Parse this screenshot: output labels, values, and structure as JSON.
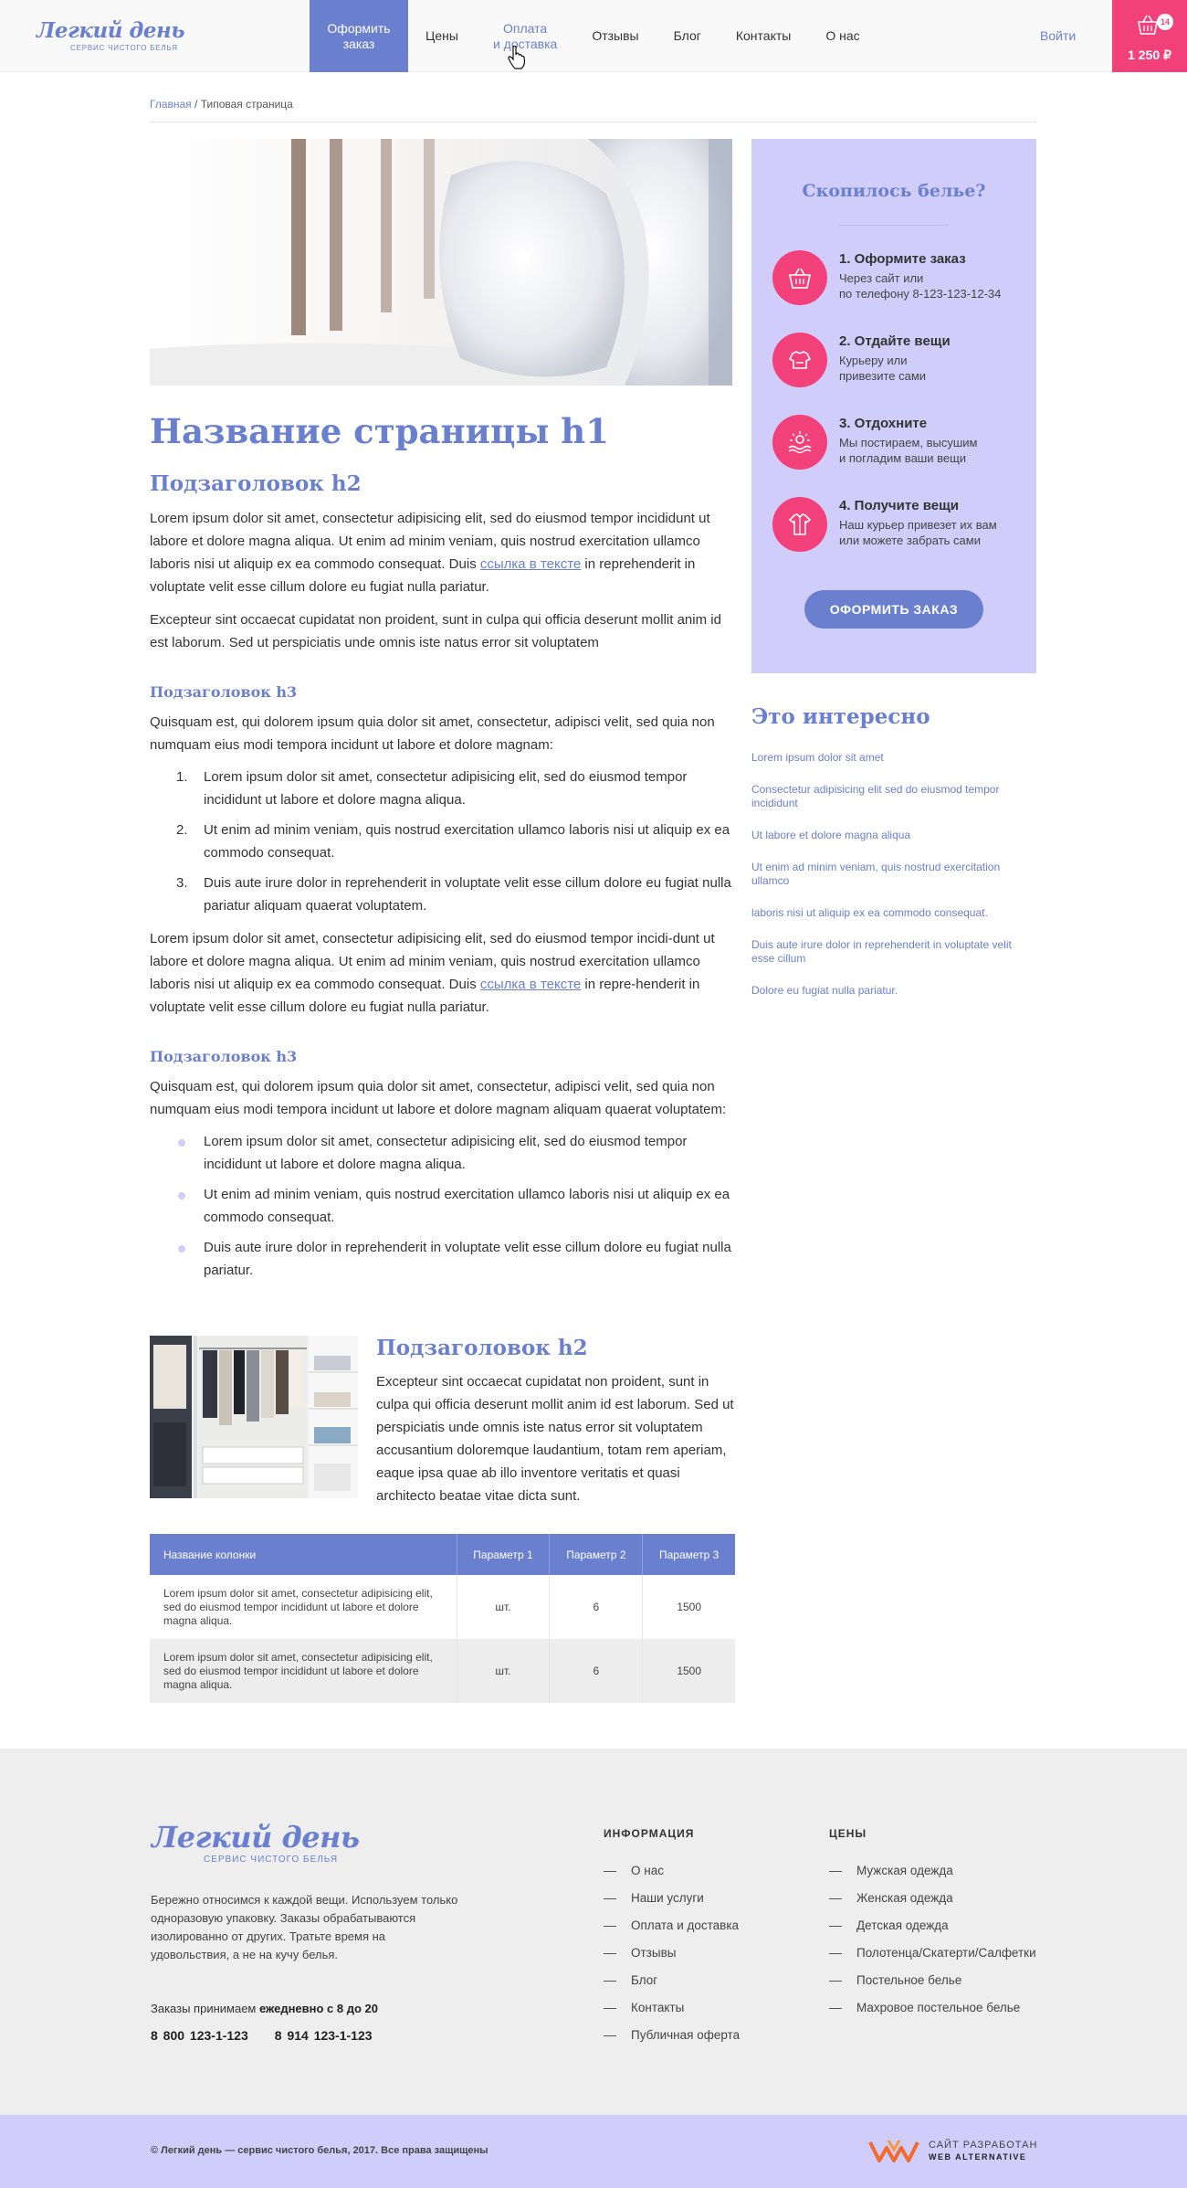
{
  "header": {
    "logo_main": "Легкий день",
    "logo_sub": "СЕРВИС ЧИСТОГО БЕЛЬЯ",
    "nav": [
      {
        "label": "Оформить\nзаказ"
      },
      {
        "label": "Цены"
      },
      {
        "label": "Оплата\nи доставка"
      },
      {
        "label": "Отзывы"
      },
      {
        "label": "Блог"
      },
      {
        "label": "Контакты"
      },
      {
        "label": "О нас"
      }
    ],
    "login": "Войти",
    "cart_count": "14",
    "cart_total": "1 250 ₽",
    "colors": {
      "accent": "#6a80cf",
      "cart": "#f2407a",
      "sidebar": "#d0cdfb"
    }
  },
  "breadcrumb": {
    "home": "Главная",
    "separator": " / ",
    "current": "Типовая страница"
  },
  "content": {
    "h1": "Название страницы h1",
    "h2_1": "Подзаголовок h2",
    "p1_a": "Lorem ipsum dolor sit amet, consectetur adipisicing elit, sed do eiusmod tempor incididunt ut labore et dolore magna aliqua. Ut enim ad minim veniam, quis nostrud exercitation ullamco laboris nisi ut aliquip ex ea commodo consequat. Duis ",
    "p1_link": "ссылка в тексте",
    "p1_b": " in reprehenderit in voluptate velit esse cillum dolore eu fugiat nulla pariatur.",
    "p2": "Excepteur sint occaecat cupidatat non proident, sunt in culpa qui officia deserunt mollit anim id est laborum. Sed ut perspiciatis unde omnis iste natus error sit voluptatem",
    "h3_1": "Подзаголовок h3",
    "p3": "Quisquam est, qui dolorem ipsum quia dolor sit amet, consectetur, adipisci velit, sed quia non numquam eius modi tempora incidunt ut labore et dolore magnam:",
    "ol": [
      {
        "num": "1.",
        "text": "Lorem ipsum dolor sit amet, consectetur adipisicing elit, sed do eiusmod tempor incididunt ut labore et dolore magna aliqua."
      },
      {
        "num": "2.",
        "text": "Ut enim ad minim veniam, quis nostrud exercitation ullamco laboris nisi ut aliquip ex ea commodo consequat."
      },
      {
        "num": "3.",
        "text": "Duis aute irure dolor in reprehenderit in voluptate velit esse cillum dolore eu fugiat nulla pariatur aliquam quaerat voluptatem."
      }
    ],
    "p4_a": "Lorem ipsum dolor sit amet, consectetur adipisicing elit, sed do eiusmod tempor incidi-dunt ut labore et dolore magna aliqua. Ut enim ad minim veniam, quis nostrud exercitation ullamco laboris nisi ut aliquip ex ea commodo consequat. Duis ",
    "p4_link": "ссылка в тексте",
    "p4_b": " in repre-henderit in voluptate velit esse cillum dolore eu fugiat nulla pariatur.",
    "h3_2": "Подзаголовок h3",
    "p5": "Quisquam est, qui dolorem ipsum quia dolor sit amet, consectetur, adipisci velit, sed quia non numquam eius modi tempora incidunt ut labore et dolore magnam aliquam quaerat voluptatem:",
    "ul": [
      "Lorem ipsum dolor sit amet, consectetur adipisicing elit, sed do eiusmod tempor incididunt ut labore et dolore magna aliqua.",
      "Ut enim ad minim veniam, quis nostrud exercitation ullamco laboris nisi ut aliquip ex ea commodo consequat.",
      "Duis aute irure dolor in reprehenderit in voluptate velit esse cillum dolore eu fugiat nulla pariatur."
    ],
    "h2_2": "Подзаголовок h2",
    "p6": "Excepteur sint occaecat cupidatat non proident, sunt in culpa qui officia deserunt mollit anim id est laborum. Sed ut perspiciatis unde omnis iste natus error sit voluptatem accusantium doloremque laudantium, totam rem aperiam, eaque ipsa quae ab illo inventore veritatis et quasi architecto beatae vitae dicta sunt."
  },
  "table": {
    "headers": [
      "Название колонки",
      "Параметр 1",
      "Параметр 2",
      "Параметр 3"
    ],
    "rows": [
      [
        "Lorem ipsum dolor sit amet, consectetur adipisicing elit, sed do eiusmod tempor incididunt ut labore et dolore magna aliqua.",
        "шт.",
        "6",
        "1500"
      ],
      [
        "Lorem ipsum dolor sit amet, consectetur adipisicing elit, sed do eiusmod tempor incididunt ut labore et dolore magna aliqua.",
        "шт.",
        "6",
        "1500"
      ]
    ]
  },
  "sidebar": {
    "title": "Скопилось белье?",
    "steps": [
      {
        "title": "1. Оформите заказ",
        "desc": "Через сайт или\nпо телефону 8-123-123-12-34",
        "icon": "basket-icon"
      },
      {
        "title": "2. Отдайте вещи",
        "desc": "Курьеру или\nпривезите сами",
        "icon": "clothes-icon"
      },
      {
        "title": "3. Отдохните",
        "desc": "Мы постираем, высушим\nи погладим ваши вещи",
        "icon": "relax-icon"
      },
      {
        "title": "4. Получите вещи",
        "desc": "Наш курьер привезет их вам\nили можете забрать сами",
        "icon": "shirt-icon"
      }
    ],
    "button": "ОФОРМИТЬ ЗАКАЗ",
    "interest_title": "Это интересно",
    "interest_links": [
      "Lorem ipsum dolor sit amet",
      "Consectetur adipisicing elit sed do eiusmod tempor incididunt",
      "Ut labore et dolore magna aliqua",
      "Ut enim ad minim veniam, quis nostrud exercitation ullamco",
      "laboris nisi ut aliquip ex ea commodo consequat.",
      "Duis aute irure dolor in reprehenderit in voluptate velit esse cillum",
      "Dolore eu fugiat nulla pariatur."
    ]
  },
  "footer": {
    "logo_main": "Легкий день",
    "logo_sub": "СЕРВИС ЧИСТОГО БЕЛЬЯ",
    "about": "Бережно относимся к каждой вещи. Используем только одноразовую упаковку.  Заказы обрабатываются изолированно от других. Тратьте время на удовольствия, а не на кучу белья.",
    "hours_prefix": "Заказы  принимаем ",
    "hours_bold": "ежедневно с 8 до 20",
    "phone1": "8 800 123-1-123",
    "phone2": "8 914  123-1-123",
    "info_title": "ИНФОРМАЦИЯ",
    "info_links": [
      "О нас",
      "Наши услуги",
      "Оплата и доставка",
      "Отзывы",
      "Блог",
      "Контакты",
      "Публичная оферта"
    ],
    "prices_title": "ЦЕНЫ",
    "prices_links": [
      "Мужская одежда",
      "Женская одежда",
      "Детская одежда",
      "Полотенца/Скатерти/Салфетки",
      "Постельное белье",
      "Махровое постельное белье"
    ],
    "copyright": "© Легкий день  — сервис чистого белья, 2017. Все права защищены",
    "dev_line1": "САЙТ РАЗРАБОТАН",
    "dev_line2": "WEB ALTERNATIVE"
  }
}
